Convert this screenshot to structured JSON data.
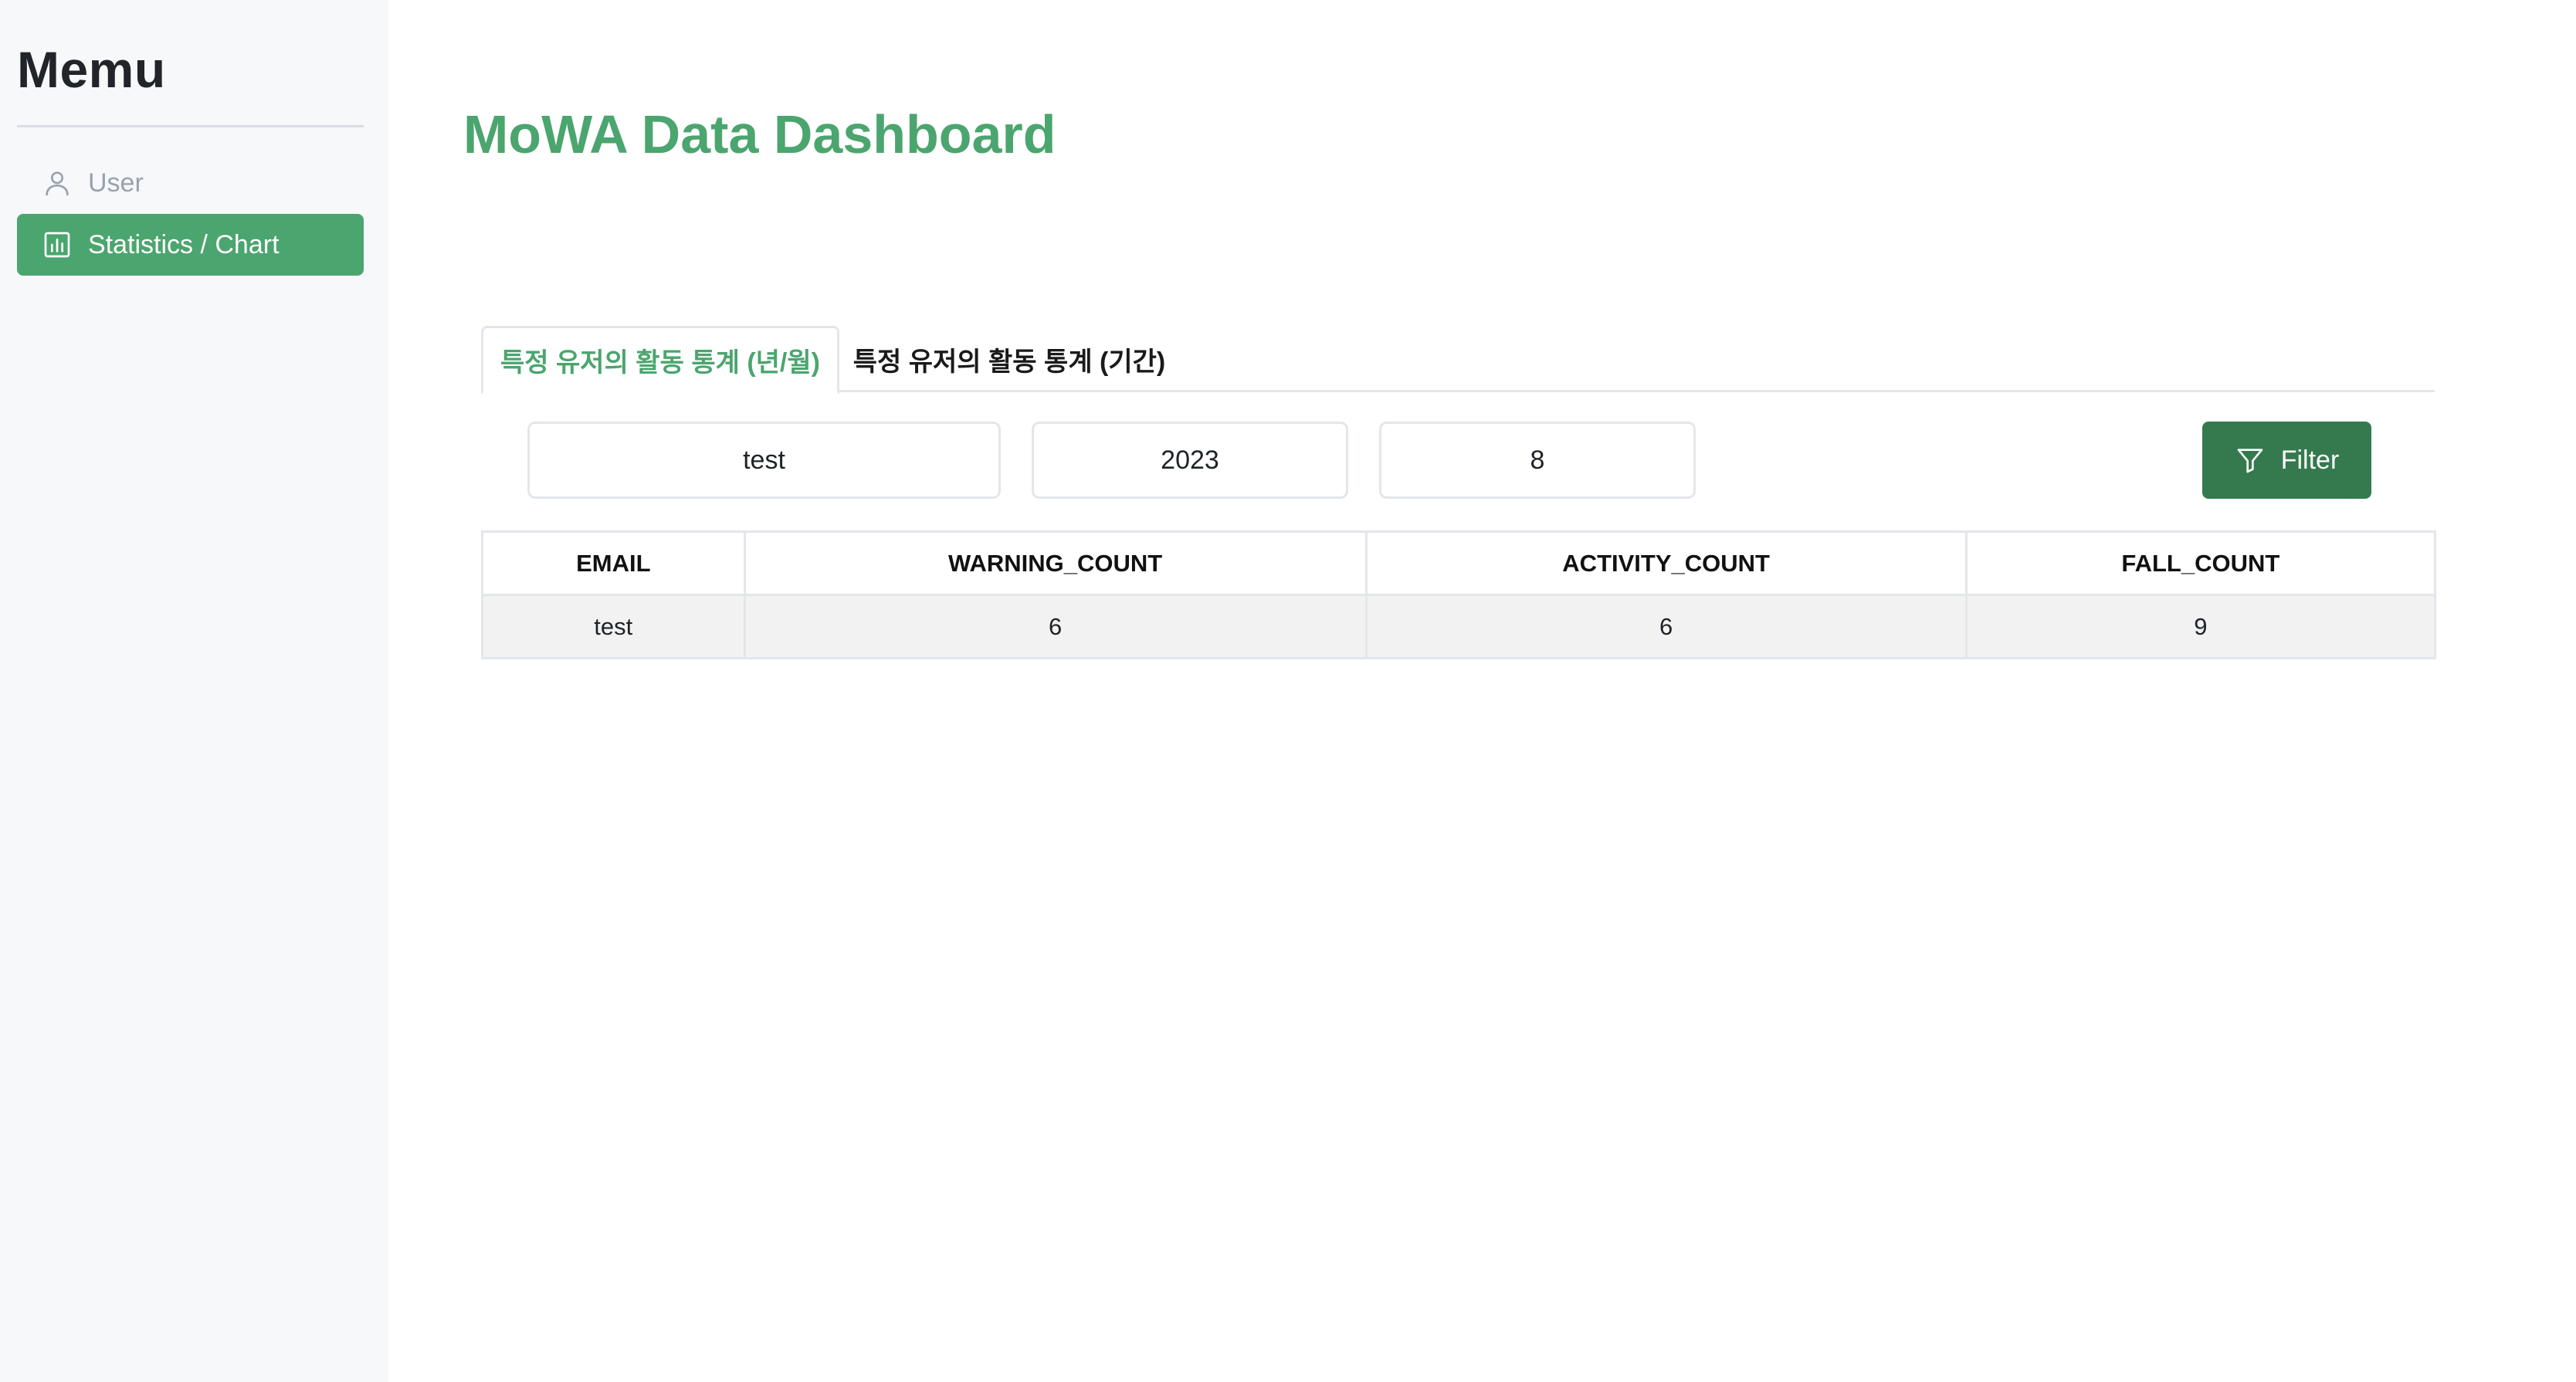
{
  "sidebar": {
    "title": "Memu",
    "items": [
      {
        "label": "User",
        "icon": "user-icon",
        "active": false
      },
      {
        "label": "Statistics / Chart",
        "icon": "bar-chart-icon",
        "active": true
      }
    ]
  },
  "main": {
    "title": "MoWA Data Dashboard"
  },
  "tabs": [
    {
      "label": "특정 유저의 활동 통계 (년/월)",
      "active": true
    },
    {
      "label": "특정 유저의 활동 통계 (기간)",
      "active": false
    }
  ],
  "filters": {
    "email": "test",
    "year": "2023",
    "month": "8",
    "button_label": "Filter",
    "button_icon": "filter-icon"
  },
  "table": {
    "columns": [
      "EMAIL",
      "WARNING_COUNT",
      "ACTIVITY_COUNT",
      "FALL_COUNT"
    ],
    "rows": [
      [
        "test",
        "6",
        "6",
        "9"
      ]
    ]
  },
  "colors": {
    "accent": "#4ba56e",
    "button": "#347a4e",
    "sidebar_bg": "#f6f8fa"
  }
}
